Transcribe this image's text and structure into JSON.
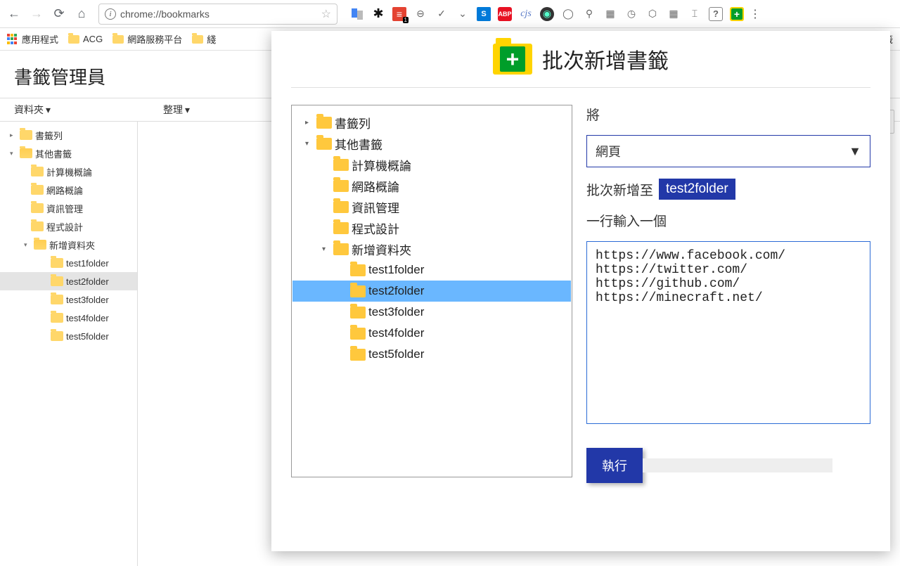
{
  "browser": {
    "url": "chrome://bookmarks",
    "extensions": [
      "translate",
      "evernote",
      "todoist",
      "convert",
      "check",
      "pocket",
      "speed",
      "abp",
      "cjs",
      "robot",
      "globe",
      "zoom",
      "tools",
      "timer",
      "box",
      "grid",
      "edit",
      "help",
      "batch-add"
    ],
    "todoist_badge": "1"
  },
  "bookmarks_bar": {
    "apps": "應用程式",
    "items": [
      "ACG",
      "網路服務平台",
      "綫"
    ],
    "right": "書籤"
  },
  "page": {
    "title": "書籤管理員",
    "toolbar": {
      "folders": "資料夾",
      "organize": "整理"
    },
    "tree": {
      "root1": "書籤列",
      "root2": "其他書籤",
      "children": [
        "計算機概論",
        "網路概論",
        "資訊管理",
        "程式設計"
      ],
      "newfolder": "新增資料夾",
      "testfolders": [
        "test1folder",
        "test2folder",
        "test3folder",
        "test4folder",
        "test5folder"
      ],
      "selected": "test2folder"
    }
  },
  "popup": {
    "title": "批次新增書籤",
    "folder_tree": {
      "root1": "書籤列",
      "root2": "其他書籤",
      "children": [
        "計算機概論",
        "網路概論",
        "資訊管理",
        "程式設計"
      ],
      "newfolder": "新增資料夾",
      "testfolders": [
        "test1folder",
        "test2folder",
        "test3folder",
        "test4folder",
        "test5folder"
      ],
      "selected": "test2folder"
    },
    "form": {
      "label_type": "將",
      "select_value": "網頁",
      "label_target_prefix": "批次新增至",
      "target_folder": "test2folder",
      "label_urls": "一行輸入一個",
      "urls_value": "https://www.facebook.com/\nhttps://twitter.com/\nhttps://github.com/\nhttps://minecraft.net/",
      "execute": "執行"
    }
  }
}
